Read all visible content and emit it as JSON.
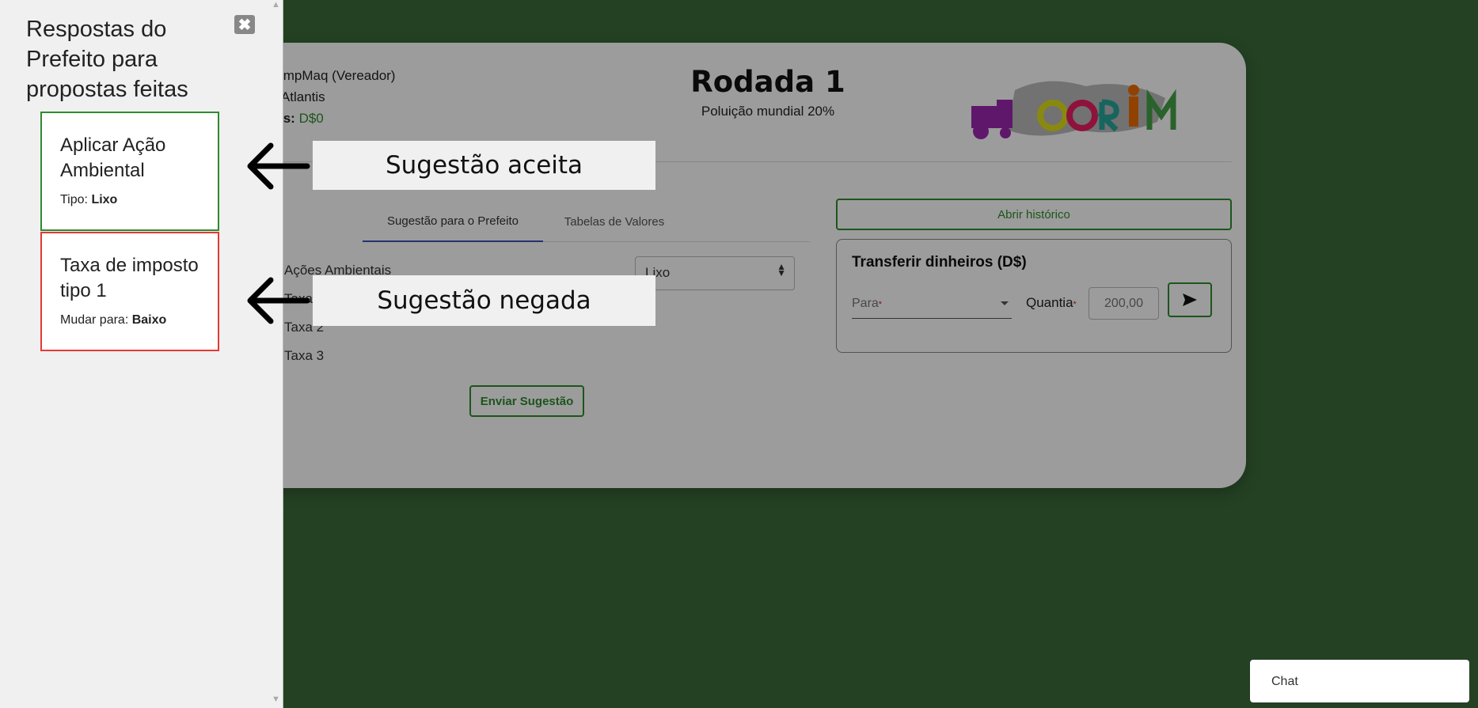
{
  "header": {
    "player_label_suffix": ":",
    "player_value": "EmpMaq (Vereador)",
    "city_label_suffix": "e:",
    "city_value": "Atlantis",
    "money_label_suffix": "iros:",
    "money_value": "D$0",
    "round_title": "Rodada 1",
    "pollution_text": "Poluição mundial 20%",
    "logo_text": "CORIM"
  },
  "tabs": [
    {
      "label": "Sugestão para o Prefeito"
    },
    {
      "label": "Tabelas de Valores"
    }
  ],
  "suggestion": {
    "actions": [
      "Ações Ambientais",
      "Taxa",
      "Taxa 2",
      "Taxa 3"
    ],
    "select_value": "Lixo",
    "send_label": "Enviar Sugestão"
  },
  "history_button": "Abrir histórico",
  "transfer": {
    "title": "Transferir dinheiros (D$)",
    "to_label": "Para",
    "required_mark": "*",
    "quantity_label": "Quantia",
    "quantity_placeholder": "200,00"
  },
  "side_panel": {
    "title": "Respostas do Prefeito para propostas feitas",
    "responses": [
      {
        "title": "Aplicar Ação Ambiental",
        "detail_label": "Tipo:",
        "detail_value": "Lixo",
        "status_color": "#2e8b2e"
      },
      {
        "title": "Taxa de imposto tipo 1",
        "detail_label": "Mudar para:",
        "detail_value": "Baixo",
        "status_color": "#e53935"
      }
    ]
  },
  "annotations": {
    "accepted": "Sugestão aceita",
    "denied": "Sugestão negada"
  },
  "chat": {
    "label": "Chat"
  },
  "colors": {
    "background": "#3b6b3a",
    "accent": "#2e8b2e",
    "tab_indicator": "#3f51b5"
  }
}
